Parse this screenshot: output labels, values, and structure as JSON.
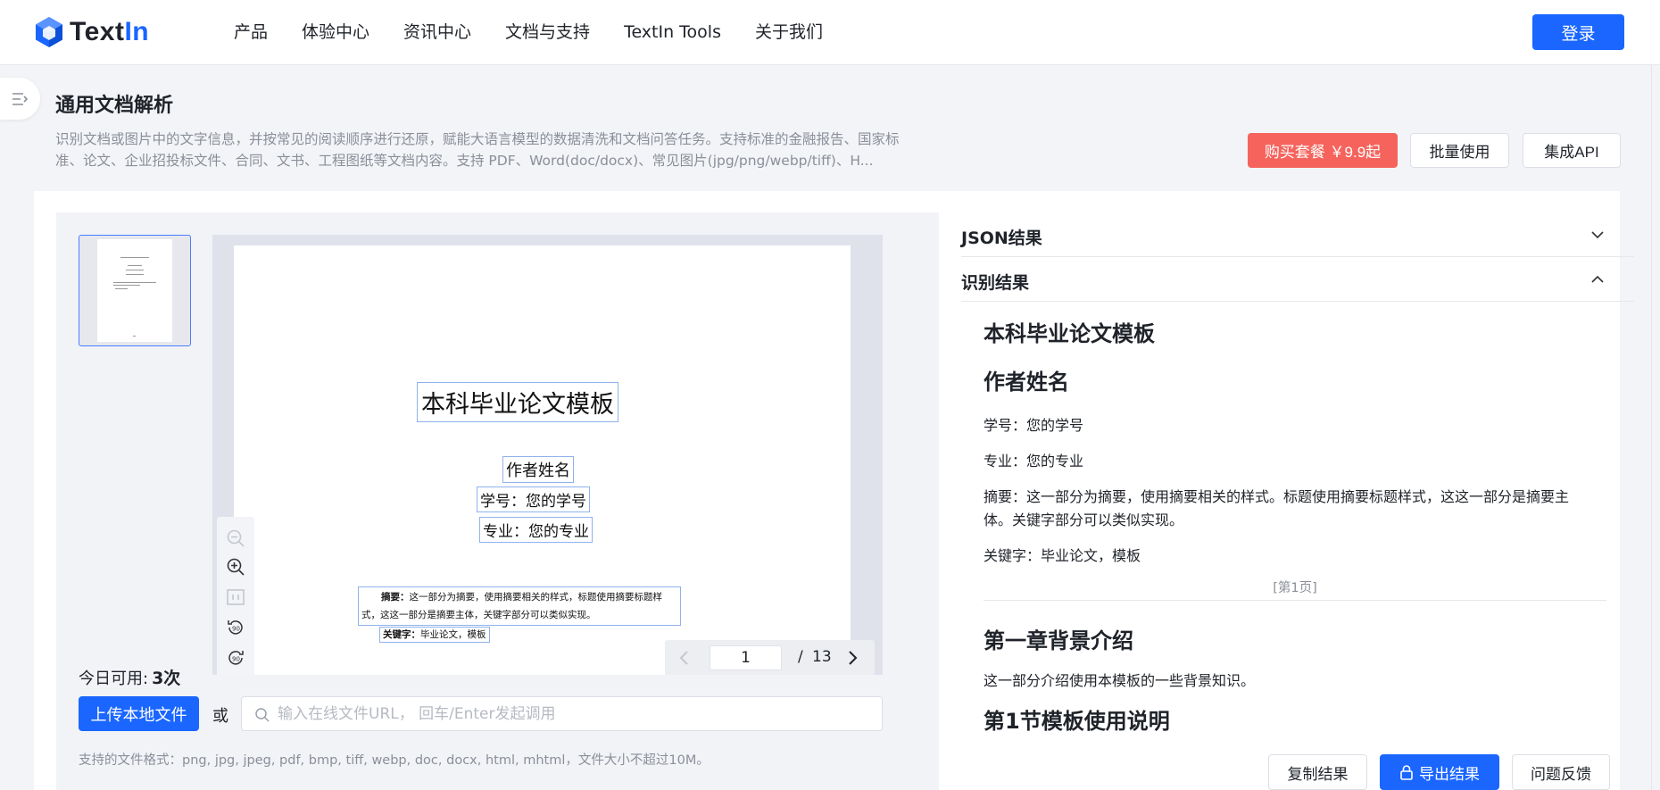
{
  "brand": {
    "name_main": "Text",
    "name_accent": "In",
    "accent_color": "#1a66ff"
  },
  "nav": {
    "items": [
      {
        "label": "产品"
      },
      {
        "label": "体验中心"
      },
      {
        "label": "资讯中心"
      },
      {
        "label": "文档与支持"
      },
      {
        "label": "TextIn Tools"
      },
      {
        "label": "关于我们"
      }
    ],
    "login_label": "登录"
  },
  "header": {
    "title": "通用文档解析",
    "description": "识别文档或图片中的文字信息，并按常见的阅读顺序进行还原，赋能大语言模型的数据清洗和文档问答任务。支持标准的金融报告、国家标准、论文、企业招投标文件、合同、文书、工程图纸等文档内容。支持 PDF、Word(doc/docx)、常见图片(jpg/png/webp/tiff)、H...",
    "buy_label": "购买套餐  ￥9.9起",
    "buy_color": "#f5635c",
    "batch_label": "批量使用",
    "api_label": "集成API"
  },
  "viewer": {
    "doc": {
      "title": "本科毕业论文模板",
      "author": "作者姓名",
      "student_id": "学号：您的学号",
      "major": "专业：您的专业",
      "abstract_label": "摘要：",
      "abstract_text": "这一部分为摘要，使用摘要相关的样式，标题使用摘要标题样式，这这一部分是摘要主体，关键字部分可以类似实现。",
      "keywords_label": "关键字：",
      "keywords_text": "毕业论文，模板"
    },
    "zoom_tools": [
      "zoom-out-icon",
      "zoom-in-icon",
      "fit-page-icon",
      "rotate-left-icon",
      "rotate-right-icon"
    ],
    "pager": {
      "current": "1",
      "separator": "/",
      "total": "13"
    }
  },
  "upload": {
    "daily_label": "今日可用:",
    "daily_count": "3次",
    "upload_label": "上传本地文件",
    "or_label": "或",
    "url_placeholder": "输入在线文件URL， 回车/Enter发起调用",
    "formats_text": "支持的文件格式：png, jpg, jpeg, pdf, bmp, tiff, webp, doc, docx, html, mhtml，文件大小不超过10M。"
  },
  "results": {
    "json_label": "JSON结果",
    "result_label": "识别结果",
    "content": {
      "h1_title": "本科毕业论文模板",
      "h1_author": "作者姓名",
      "p_sid": "学号：您的学号",
      "p_major": "专业：您的专业",
      "p_abstract": "摘要：这一部分为摘要，使用摘要相关的样式。标题使用摘要标题样式，这这一部分是摘要主体。关键字部分可以类似实现。",
      "p_keywords": "关键字：毕业论文，模板",
      "page_mark": "[第1页]",
      "h1_chapter": "第一章背景介绍",
      "p_chapter": "这一部分介绍使用本模板的一些背景知识。",
      "h1_section": "第1节模板使用说明"
    },
    "actions": {
      "copy_label": "复制结果",
      "export_label": "导出结果",
      "feedback_label": "问题反馈"
    }
  }
}
